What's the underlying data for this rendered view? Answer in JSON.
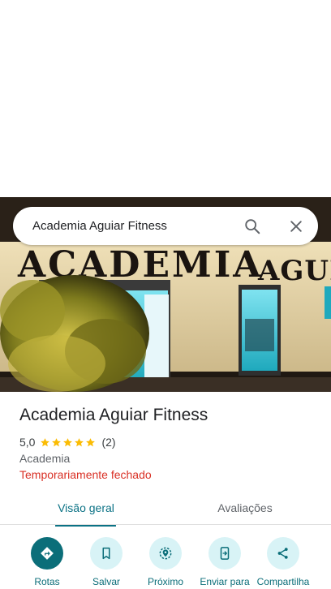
{
  "search": {
    "query": "Academia Aguiar Fitness",
    "search_icon": "search-icon",
    "close_icon": "close-icon"
  },
  "photo": {
    "sign_text": "ACADEMIA",
    "sign_text_right": "AGUIAR"
  },
  "place": {
    "title": "Academia Aguiar Fitness",
    "rating": "5,0",
    "stars": 5,
    "review_count": "(2)",
    "category": "Academia",
    "status": "Temporariamente fechado"
  },
  "tabs": [
    {
      "label": "Visão geral",
      "selected": true
    },
    {
      "label": "Avaliações",
      "selected": false
    }
  ],
  "actions": [
    {
      "label": "Rotas",
      "icon": "directions-icon"
    },
    {
      "label": "Salvar",
      "icon": "bookmark-icon"
    },
    {
      "label": "Próximo",
      "icon": "nearby-icon"
    },
    {
      "label": "Enviar para",
      "icon": "send-to-phone-icon"
    },
    {
      "label": "Compartilha",
      "icon": "share-icon"
    }
  ],
  "colors": {
    "accent": "#0b6e79",
    "accent_light": "#d8f3f6",
    "closed_red": "#d93025",
    "star_yellow": "#fbbc04"
  }
}
